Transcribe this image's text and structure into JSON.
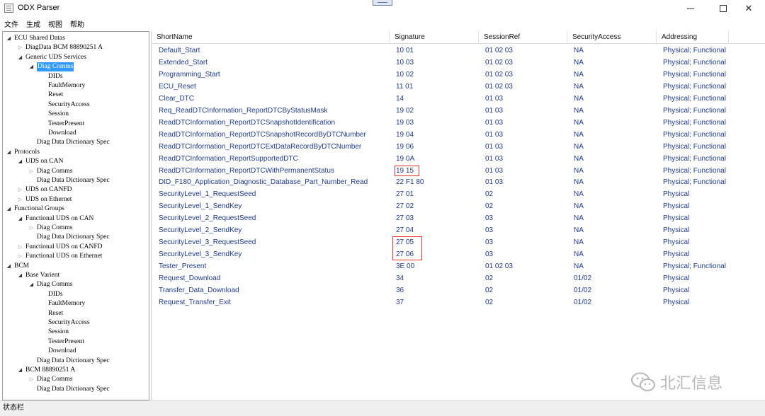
{
  "window": {
    "title": "ODX Parser",
    "minimize_glyph": "minimize-icon",
    "maximize_glyph": "maximize-icon",
    "close_label": "✕"
  },
  "menu": [
    "文件",
    "生成",
    "视图",
    "帮助"
  ],
  "tree": [
    {
      "label": "ECU Shared Datas",
      "level": 0,
      "expander": "open"
    },
    {
      "label": "DiagData BCM 88890251 A",
      "level": 1,
      "expander": "closed"
    },
    {
      "label": "Generic UDS Services",
      "level": 1,
      "expander": "open"
    },
    {
      "label": "Diag Comms",
      "level": 2,
      "expander": "open",
      "selected": true
    },
    {
      "label": "DIDs",
      "level": 3,
      "expander": "none"
    },
    {
      "label": "FaultMemory",
      "level": 3,
      "expander": "none"
    },
    {
      "label": "Reset",
      "level": 3,
      "expander": "none"
    },
    {
      "label": "SecurityAccess",
      "level": 3,
      "expander": "none"
    },
    {
      "label": "Session",
      "level": 3,
      "expander": "none"
    },
    {
      "label": "TesterPresent",
      "level": 3,
      "expander": "none"
    },
    {
      "label": "Download",
      "level": 3,
      "expander": "none"
    },
    {
      "label": "Diag Data Dictionary Spec",
      "level": 2,
      "expander": "none"
    },
    {
      "label": "Protocols",
      "level": 0,
      "expander": "open"
    },
    {
      "label": "UDS on CAN",
      "level": 1,
      "expander": "open"
    },
    {
      "label": "Diag Comms",
      "level": 2,
      "expander": "closed"
    },
    {
      "label": "Diag Data Dictionary Spec",
      "level": 2,
      "expander": "none"
    },
    {
      "label": "UDS on CANFD",
      "level": 1,
      "expander": "closed"
    },
    {
      "label": "UDS on Ethernet",
      "level": 1,
      "expander": "closed"
    },
    {
      "label": "Functional Groups",
      "level": 0,
      "expander": "open"
    },
    {
      "label": "Functional UDS on CAN",
      "level": 1,
      "expander": "open"
    },
    {
      "label": "Diag Comms",
      "level": 2,
      "expander": "closed"
    },
    {
      "label": "Diag Data Dictionary Spec",
      "level": 2,
      "expander": "none"
    },
    {
      "label": "Functional UDS on CANFD",
      "level": 1,
      "expander": "closed"
    },
    {
      "label": "Functional UDS on Ethernet",
      "level": 1,
      "expander": "closed"
    },
    {
      "label": "BCM",
      "level": 0,
      "expander": "open"
    },
    {
      "label": "Base Varient",
      "level": 1,
      "expander": "open"
    },
    {
      "label": "Diag Comms",
      "level": 2,
      "expander": "open"
    },
    {
      "label": "DIDs",
      "level": 3,
      "expander": "none"
    },
    {
      "label": "FaultMemory",
      "level": 3,
      "expander": "none"
    },
    {
      "label": "Reset",
      "level": 3,
      "expander": "none"
    },
    {
      "label": "SecurityAccess",
      "level": 3,
      "expander": "none"
    },
    {
      "label": "Session",
      "level": 3,
      "expander": "none"
    },
    {
      "label": "TesterPresent",
      "level": 3,
      "expander": "none"
    },
    {
      "label": "Download",
      "level": 3,
      "expander": "none"
    },
    {
      "label": "Diag Data Dictionary Spec",
      "level": 2,
      "expander": "none"
    },
    {
      "label": "BCM 88890251 A",
      "level": 1,
      "expander": "open"
    },
    {
      "label": "Diag Comms",
      "level": 2,
      "expander": "closed"
    },
    {
      "label": "Diag Data Dictionary Spec",
      "level": 2,
      "expander": "none"
    }
  ],
  "grid": {
    "columns": [
      "ShortName",
      "Signature",
      "SessionRef",
      "SecurityAccess",
      "Addressing"
    ],
    "rows": [
      [
        "Default_Start",
        "10 01",
        "01 02 03",
        "NA",
        "Physical; Functional"
      ],
      [
        "Extended_Start",
        "10 03",
        "01 02 03",
        "NA",
        "Physical; Functional"
      ],
      [
        "Programming_Start",
        "10 02",
        "01 02 03",
        "NA",
        "Physical; Functional"
      ],
      [
        "ECU_Reset",
        "11 01",
        "01 02 03",
        "NA",
        "Physical; Functional"
      ],
      [
        "Clear_DTC",
        "14",
        "01 03",
        "NA",
        "Physical; Functional"
      ],
      [
        "Req_ReadDTCInformation_ReportDTCByStatusMask",
        "19 02",
        "01 03",
        "NA",
        "Physical; Functional"
      ],
      [
        "ReadDTCInformation_ReportDTCSnapshotIdentification",
        "19 03",
        "01 03",
        "NA",
        "Physical; Functional"
      ],
      [
        "ReadDTCInformation_ReportDTCSnapshotRecordByDTCNumber",
        "19 04",
        "01 03",
        "NA",
        "Physical; Functional"
      ],
      [
        "ReadDTCInformation_ReportDTCExtDataRecordByDTCNumber",
        "19 06",
        "01 03",
        "NA",
        "Physical; Functional"
      ],
      [
        "ReadDTCInformation_ReportSupportedDTC",
        "19 0A",
        "01 03",
        "NA",
        "Physical; Functional"
      ],
      [
        "ReadDTCInformation_ReportDTCWithPermanentStatus",
        "19 15",
        "01 03",
        "NA",
        "Physical; Functional"
      ],
      [
        "DID_F180_Application_Diagnostic_Database_Part_Number_Read",
        "22 F1 80",
        "01 03",
        "NA",
        "Physical; Functional"
      ],
      [
        "SecurityLevel_1_RequestSeed",
        "27 01",
        "02",
        "NA",
        "Physical"
      ],
      [
        "SecurityLevel_1_SendKey",
        "27 02",
        "02",
        "NA",
        "Physical"
      ],
      [
        "SecurityLevel_2_RequestSeed",
        "27 03",
        "03",
        "NA",
        "Physical"
      ],
      [
        "SecurityLevel_2_SendKey",
        "27 04",
        "03",
        "NA",
        "Physical"
      ],
      [
        "SecurityLevel_3_RequestSeed",
        "27 05",
        "03",
        "NA",
        "Physical"
      ],
      [
        "SecurityLevel_3_SendKey",
        "27 06",
        "03",
        "NA",
        "Physical"
      ],
      [
        "Tester_Present",
        "3E 00",
        "01 02 03",
        "NA",
        "Physical; Functional"
      ],
      [
        "Request_Download",
        "34",
        "02",
        "01/02",
        "Physical"
      ],
      [
        "Transfer_Data_Download",
        "36",
        "02",
        "01/02",
        "Physical"
      ],
      [
        "Request_Transfer_Exit",
        "37",
        "02",
        "01/02",
        "Physical"
      ]
    ],
    "highlight_color": "#e53935"
  },
  "watermark": {
    "text": "北汇信息",
    "icon": "wechat-logo-icon"
  },
  "status": {
    "text": "状态栏"
  }
}
